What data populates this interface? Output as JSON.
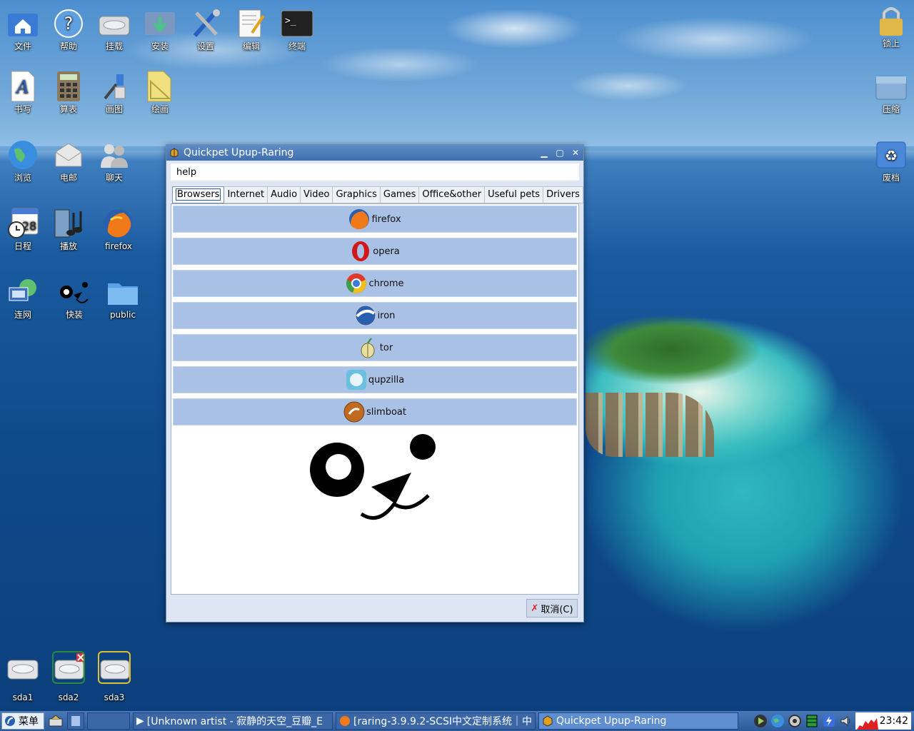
{
  "desktop": {
    "icons_left": [
      {
        "id": "file",
        "label": "文件"
      },
      {
        "id": "help",
        "label": "帮助"
      },
      {
        "id": "mount",
        "label": "挂载"
      },
      {
        "id": "install",
        "label": "安装"
      },
      {
        "id": "settings",
        "label": "设置"
      },
      {
        "id": "edit",
        "label": "编辑"
      },
      {
        "id": "terminal",
        "label": "终端"
      },
      {
        "id": "write",
        "label": "书写"
      },
      {
        "id": "calc",
        "label": "算表"
      },
      {
        "id": "paint",
        "label": "画图"
      },
      {
        "id": "draw",
        "label": "绘画"
      },
      {
        "id": "browse",
        "label": "浏览"
      },
      {
        "id": "mail",
        "label": "电邮"
      },
      {
        "id": "chat",
        "label": "聊天"
      },
      {
        "id": "calendar",
        "label": "日程"
      },
      {
        "id": "play",
        "label": "播放"
      },
      {
        "id": "firefox",
        "label": "firefox"
      },
      {
        "id": "network",
        "label": "连网"
      },
      {
        "id": "quickpet",
        "label": "快装"
      },
      {
        "id": "public",
        "label": "public"
      }
    ],
    "icons_right": [
      {
        "id": "lock",
        "label": "锁上"
      },
      {
        "id": "compress",
        "label": "压缩"
      },
      {
        "id": "trash",
        "label": "废档"
      }
    ],
    "drives": [
      {
        "id": "sda1",
        "label": "sda1"
      },
      {
        "id": "sda2",
        "label": "sda2"
      },
      {
        "id": "sda3",
        "label": "sda3"
      }
    ],
    "calendar_day": "28"
  },
  "window": {
    "title": "Quickpet Upup-Raring",
    "menu": "help",
    "tabs": [
      "Browsers",
      "Internet",
      "Audio",
      "Video",
      "Graphics",
      "Games",
      "Office&other",
      "Useful pets",
      "Drivers"
    ],
    "active_tab": "Browsers",
    "apps": [
      {
        "name": "firefox",
        "icon": "firefox-icon"
      },
      {
        "name": "opera",
        "icon": "opera-icon"
      },
      {
        "name": "chrome",
        "icon": "chrome-icon"
      },
      {
        "name": "iron",
        "icon": "iron-icon"
      },
      {
        "name": "tor",
        "icon": "tor-icon"
      },
      {
        "name": "qupzilla",
        "icon": "qupzilla-icon"
      },
      {
        "name": "slimboat",
        "icon": "slimboat-icon"
      }
    ],
    "cancel_label": "取消(C)"
  },
  "taskbar": {
    "menu_label": "菜单",
    "tasks": [
      {
        "label": "[Unknown artist - 寂静的天空_豆瓣_E"
      },
      {
        "label": "[raring-3.9.9.2-SCSI中文定制系统｜中"
      },
      {
        "label": "Quickpet Upup-Raring"
      }
    ],
    "clock": "23:42"
  },
  "colors": {
    "accent": "#4a79b9",
    "app_button": "#a9c1e4",
    "titlebar": "#3f6fae"
  }
}
